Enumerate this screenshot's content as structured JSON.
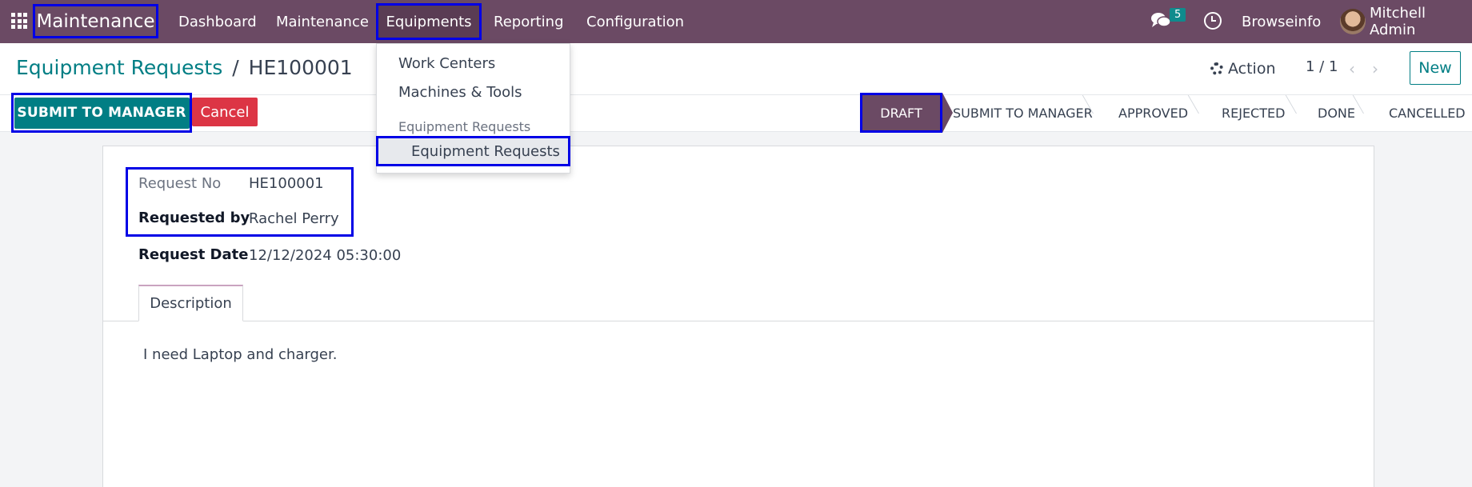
{
  "nav": {
    "app_title": "Maintenance",
    "items": [
      "Dashboard",
      "Maintenance",
      "Equipments",
      "Reporting",
      "Configuration"
    ],
    "chat_count": "5",
    "company": "Browseinfo",
    "user": "Mitchell Admin"
  },
  "dropdown": {
    "items": [
      "Work Centers",
      "Machines & Tools"
    ],
    "section_header": "Equipment Requests",
    "active_item": "Equipment Requests"
  },
  "breadcrumb": {
    "parent": "Equipment Requests",
    "separator": "/",
    "current": "HE100001"
  },
  "control": {
    "action_label": "Action",
    "pager": "1 / 1",
    "new_label": "New"
  },
  "buttons": {
    "submit": "SUBMIT TO MANAGER",
    "cancel": "Cancel"
  },
  "stages": [
    "DRAFT",
    "SUBMIT TO MANAGER",
    "APPROVED",
    "REJECTED",
    "DONE",
    "CANCELLED"
  ],
  "form": {
    "request_no_label": "Request No",
    "request_no": "HE100001",
    "requested_by_label": "Requested by",
    "requested_by": "Rachel Perry",
    "request_date_label": "Request Date",
    "request_date": "12/12/2024 05:30:00",
    "tab": "Description",
    "description": "I need Laptop and charger."
  },
  "colors": {
    "navbar": "#6b4a64",
    "primary": "#017e84",
    "danger": "#dc3545",
    "highlight": "#0000e6"
  }
}
